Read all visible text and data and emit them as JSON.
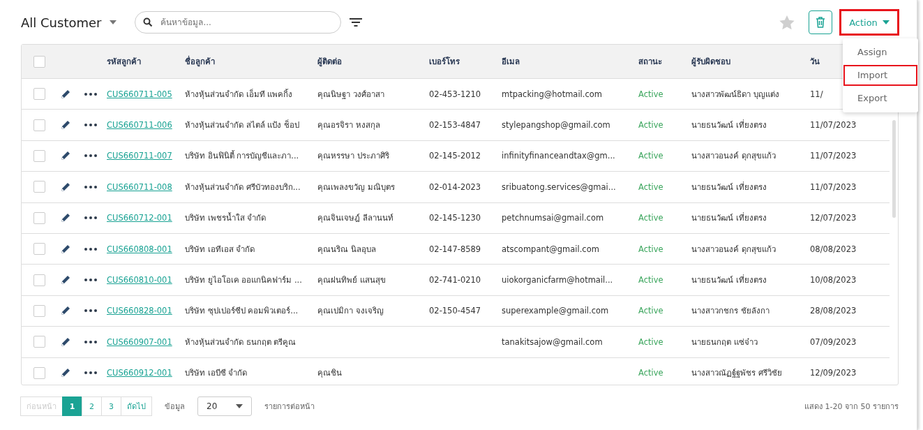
{
  "toolbar": {
    "view": "All Customer",
    "search": {
      "placeholder": "ค้นหาข้อมูล..."
    },
    "favorite": false,
    "action": {
      "label": "Action",
      "highlighted": true
    }
  },
  "action_menu": [
    {
      "label": "Assign",
      "highlighted": false
    },
    {
      "label": "Import",
      "highlighted": true
    },
    {
      "label": "Export",
      "highlighted": false
    }
  ],
  "table": {
    "all_checked": false,
    "columns": [
      "รหัสลูกค้า",
      "ชื่อลูกค้า",
      "ผู้ติดต่อ",
      "เบอร์โทร",
      "อีเมล",
      "สถานะ",
      "ผู้รับผิดชอบ",
      "วัน"
    ],
    "rows": [
      {
        "checked": false,
        "code": "CUS660711-005",
        "name": "ห้างหุ้นส่วนจำกัด เอ็มที แพคกิ้ง",
        "contact": "คุณนิษฐา วงศ์อาสา",
        "phone": "02-453-1210",
        "email": "mtpacking@hotmail.com",
        "status": "Active",
        "owner": "นางสาวพัฒน์ธิดา บุญแต่ง",
        "date": "11/"
      },
      {
        "checked": false,
        "code": "CUS660711-006",
        "name": "ห้างหุ้นส่วนจำกัด สไตล์ แป้ง ช็อป",
        "contact": "คุณอรจิรา หงสกุล",
        "phone": "02-153-4847",
        "email": "stylepangshop@gmail.com",
        "status": "Active",
        "owner": "นายธนวัฒน์ เที่ยงตรง",
        "date": "11/07/2023"
      },
      {
        "checked": false,
        "code": "CUS660711-007",
        "name": "บริษัท อินฟินิตี้ การบัญชีและภา...",
        "contact": "คุณหรรษา ประภาศิริ",
        "phone": "02-145-2012",
        "email": "infinityfinanceandtax@gm...",
        "status": "Active",
        "owner": "นางสาวอนงค์ ดุกสุขแก้ว",
        "date": "11/07/2023"
      },
      {
        "checked": false,
        "code": "CUS660711-008",
        "name": "ห้างหุ้นส่วนจำกัด ศรีบัวทองบริก...",
        "contact": "คุณเพลงขวัญ มณิบุตร",
        "phone": "02-014-2023",
        "email": "sribuatong.services@gmai...",
        "status": "Active",
        "owner": "นายธนวัฒน์ เที่ยงตรง",
        "date": "11/07/2023"
      },
      {
        "checked": false,
        "code": "CUS660712-001",
        "name": "บริษัท เพชรน้ำใส จำกัด",
        "contact": "คุณจินเจษฎ์ ลีลานนท์",
        "phone": "02-145-1230",
        "email": "petchnumsai@gmail.com",
        "status": "Active",
        "owner": "นายธนวัฒน์ เที่ยงตรง",
        "date": "12/07/2023"
      },
      {
        "checked": false,
        "code": "CUS660808-001",
        "name": "บริษัท เอทีเอส จำกัด",
        "contact": "คุณนริณ นิลอุบล",
        "phone": "02-147-8589",
        "email": "atscompant@gmail.com",
        "status": "Active",
        "owner": "นางสาวอนงค์ ดุกสุขแก้ว",
        "date": "08/08/2023"
      },
      {
        "checked": false,
        "code": "CUS660810-001",
        "name": "บริษัท ยูไอโอเค ออแกนิคฟาร์ม ...",
        "contact": "คุณฝนทิพย์ แสนสุข",
        "phone": "02-741-0210",
        "email": "uiokorganicfarm@hotmail...",
        "status": "Active",
        "owner": "นายธนวัฒน์ เที่ยงตรง",
        "date": "10/08/2023"
      },
      {
        "checked": false,
        "code": "CUS660828-001",
        "name": "บริษัท ซุปเปอร์ซีป คอมพิวเตอร์...",
        "contact": "คุณเปมิกา จงเจริญ",
        "phone": "02-150-4547",
        "email": "superexample@gmail.com",
        "status": "Active",
        "owner": "นางสาวกชกร ชัยลังกา",
        "date": "28/08/2023"
      },
      {
        "checked": false,
        "code": "CUS660907-001",
        "name": "ห้างหุ้นส่วนจำกัด ธนกฤต ตรีคูณ",
        "contact": "",
        "phone": "",
        "email": "tanakitsajow@gmail.com",
        "status": "Active",
        "owner": "นายธนกฤต แซ่จ๋าว",
        "date": "07/09/2023"
      },
      {
        "checked": false,
        "code": "CUS660912-001",
        "name": "บริษัท เอบีซี จำกัด",
        "contact": "คุณชิน",
        "phone": "",
        "email": "",
        "status": "Active",
        "owner": "นางสาวณัฏฐ์ฐพัชร ศรีวิชัย",
        "date": "12/09/2023"
      }
    ]
  },
  "pagination": {
    "prev": {
      "label": "ก่อนหน้า",
      "disabled": true
    },
    "pages": [
      {
        "label": "1",
        "selected": true
      },
      {
        "label": "2",
        "selected": false
      },
      {
        "label": "3",
        "selected": false
      }
    ],
    "next": {
      "label": "ถัดไป",
      "disabled": false
    },
    "size_label": "ข้อมูล",
    "page_size": "20",
    "per_page_label": "รายการต่อหน้า",
    "summary": "แสดง 1-20 จาก 50 รายการ"
  }
}
